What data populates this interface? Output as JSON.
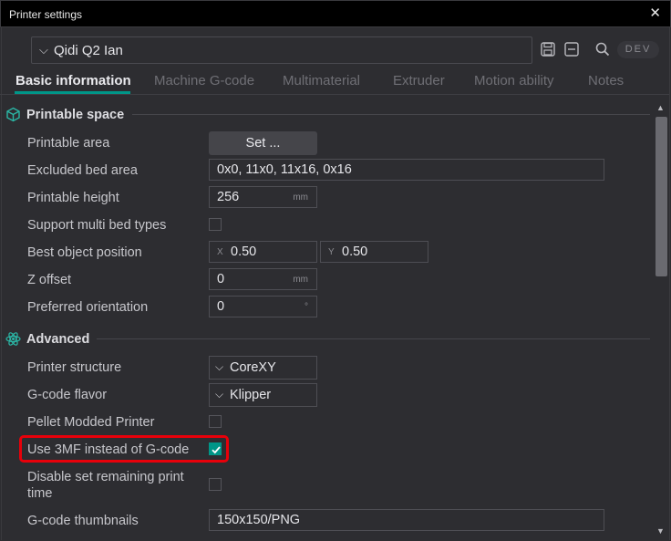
{
  "window": {
    "title": "Printer settings",
    "close_glyph": "✕"
  },
  "preset": {
    "value": "Qidi Q2 Ian",
    "chevron": "⌵"
  },
  "toolbar": {
    "save_icon": "save-icon",
    "delete_icon": "delete-icon",
    "search_icon": "search-icon",
    "dev_label": "DEV"
  },
  "tabs": [
    {
      "label": "Basic information",
      "active": true
    },
    {
      "label": "Machine G-code",
      "active": false
    },
    {
      "label": "Multimaterial",
      "active": false
    },
    {
      "label": "Extruder",
      "active": false
    },
    {
      "label": "Motion ability",
      "active": false
    },
    {
      "label": "Notes",
      "active": false
    }
  ],
  "printable_space": {
    "title": "Printable space",
    "printable_area": {
      "label": "Printable area",
      "button": "Set ..."
    },
    "excluded_bed_area": {
      "label": "Excluded bed area",
      "value": "0x0, 11x0, 11x16, 0x16"
    },
    "printable_height": {
      "label": "Printable height",
      "value": "256",
      "unit": "mm"
    },
    "support_multi_bed": {
      "label": "Support multi bed types",
      "checked": false
    },
    "best_object_position": {
      "label": "Best object position",
      "x_prefix": "X",
      "x_value": "0.50",
      "y_prefix": "Y",
      "y_value": "0.50"
    },
    "z_offset": {
      "label": "Z offset",
      "value": "0",
      "unit": "mm"
    },
    "preferred_orientation": {
      "label": "Preferred orientation",
      "value": "0",
      "unit": "°"
    }
  },
  "advanced": {
    "title": "Advanced",
    "printer_structure": {
      "label": "Printer structure",
      "value": "CoreXY"
    },
    "gcode_flavor": {
      "label": "G-code flavor",
      "value": "Klipper"
    },
    "pellet_modded": {
      "label": "Pellet Modded Printer",
      "checked": false
    },
    "use_3mf": {
      "label": "Use 3MF instead of G-code",
      "checked": true
    },
    "disable_remaining": {
      "label_line1": "Disable set remaining print",
      "label_line2": "time",
      "checked": false
    },
    "gcode_thumbnails": {
      "label": "G-code thumbnails",
      "value": "150x150/PNG"
    }
  },
  "colors": {
    "accent": "#009688",
    "highlight": "#e8000a",
    "background": "#2d2d31"
  }
}
